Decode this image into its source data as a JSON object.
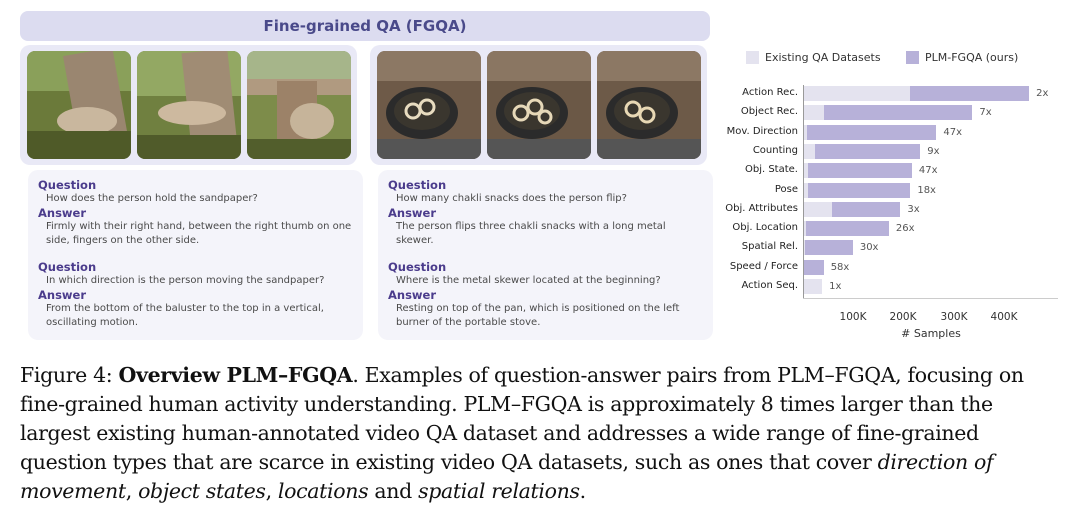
{
  "banner": {
    "title": "Fine-grained QA (FGQA)"
  },
  "left_example": {
    "q1_label": "Question",
    "q1": "How does the person hold the sandpaper?",
    "a1_label": "Answer",
    "a1": "Firmly with their right hand, between the right thumb on one side, fingers on the other side.",
    "q2_label": "Question",
    "q2": "In which direction is the person moving the sandpaper?",
    "a2_label": "Answer",
    "a2": "From the bottom of the baluster to the top in a vertical, oscillating motion."
  },
  "right_example": {
    "q1_label": "Question",
    "q1": "How many chakli snacks does the person flip?",
    "a1_label": "Answer",
    "a1": "The person flips three chakli snacks with a long metal skewer.",
    "q2_label": "Question",
    "q2": "Where is the metal skewer located at the beginning?",
    "a2_label": "Answer",
    "a2": "Resting on top of the pan, which is positioned on the left burner of the portable stove."
  },
  "legend": {
    "existing": "Existing QA Datasets",
    "ours": "PLM-FGQA (ours)"
  },
  "colors": {
    "existing": "#e4e3ef",
    "ours": "#b7b1d9",
    "accent": "#4b3c8c"
  },
  "chart_data": {
    "type": "bar",
    "orientation": "horizontal",
    "categories": [
      "Action Rec.",
      "Object Rec.",
      "Mov. Direction",
      "Counting",
      "Obj. State.",
      "Pose",
      "Obj. Attributes",
      "Obj. Location",
      "Spatial Rel.",
      "Speed / Force",
      "Action Seq."
    ],
    "series": [
      {
        "name": "Existing QA Datasets",
        "values": [
          140000,
          27000,
          5000,
          15000,
          6000,
          6000,
          38000,
          4000,
          2000,
          500,
          25000
        ]
      },
      {
        "name": "PLM-FGQA (ours)",
        "values": [
          295000,
          221000,
          174000,
          153000,
          142000,
          140000,
          127000,
          112000,
          65000,
          27000,
          25000
        ]
      }
    ],
    "multipliers": [
      "2x",
      "7x",
      "47x",
      "9x",
      "47x",
      "18x",
      "3x",
      "26x",
      "30x",
      "58x",
      "1x"
    ],
    "xticks": [
      "100K",
      "200K",
      "300K",
      "400K"
    ],
    "xlabel": "# Samples",
    "xlim": [
      0,
      330000
    ],
    "legend_position": "top"
  },
  "caption": {
    "label": "Figure 4: ",
    "title": "Overview PLM–FGQA",
    "text1": ". Examples of question-answer pairs from PLM–FGQA, focusing on fine-grained human activity understanding. PLM–FGQA is approximately 8 times larger than the largest existing human-annotated video QA dataset and addresses a wide range of fine-grained question types that are scarce in existing video QA datasets, such as ones that cover ",
    "em1": "direction of movement",
    "sep1": ", ",
    "em2": "object states",
    "sep2": ", ",
    "em3": "locations",
    "sep3": " and ",
    "em4": "spatial relations",
    "end": "."
  }
}
